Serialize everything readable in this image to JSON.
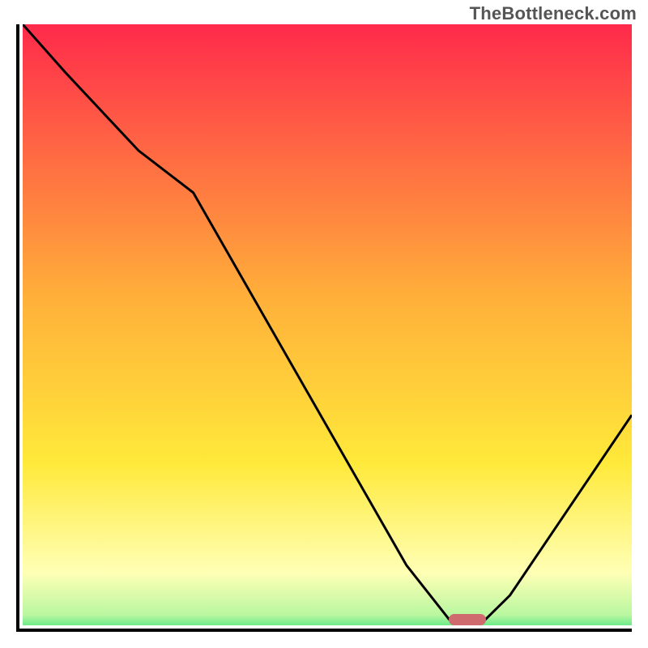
{
  "watermark": "TheBottleneck.com",
  "colors": {
    "top": "#ff2a4b",
    "mid": "#ffd93a",
    "pale": "#ffffb5",
    "green": "#2fe07a",
    "marker": "#cf6a6e",
    "curve": "#000000"
  },
  "chart_data": {
    "type": "line",
    "title": "",
    "xlabel": "",
    "ylabel": "",
    "xlim": [
      0,
      100
    ],
    "ylim": [
      0,
      100
    ],
    "series": [
      {
        "name": "bottleneck-curve",
        "x": [
          0,
          7,
          19,
          28,
          63,
          70,
          76,
          80,
          100
        ],
        "values": [
          100,
          92,
          79,
          72,
          10,
          1,
          1,
          5,
          35
        ]
      }
    ],
    "markers": [
      {
        "name": "optimal-marker",
        "x_center": 73,
        "y": 1
      }
    ],
    "gradient_stops_percent": {
      "top": 0,
      "mid_orange": 45,
      "yellow": 72,
      "pale": 90,
      "green": 100
    }
  }
}
